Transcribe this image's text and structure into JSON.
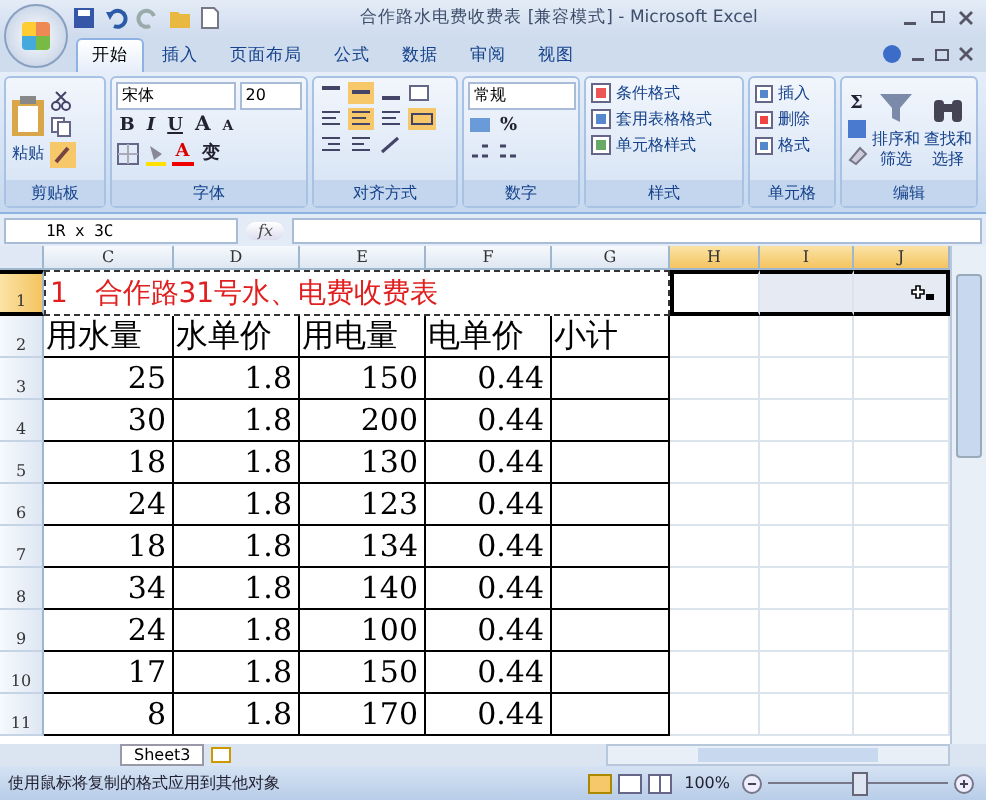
{
  "window": {
    "title": "合作路水电费收费表 [兼容模式] - Microsoft Excel"
  },
  "tabs": [
    {
      "label": "开始",
      "selected": true
    },
    {
      "label": "插入",
      "selected": false
    },
    {
      "label": "页面布局",
      "selected": false
    },
    {
      "label": "公式",
      "selected": false
    },
    {
      "label": "数据",
      "selected": false
    },
    {
      "label": "审阅",
      "selected": false
    },
    {
      "label": "视图",
      "selected": false
    }
  ],
  "ribbon": {
    "clipboard": {
      "label": "剪贴板",
      "paste": "粘贴"
    },
    "font": {
      "label": "字体",
      "family": "宋体",
      "size": "20",
      "buttons": [
        "B",
        "I",
        "U"
      ],
      "grow": "A",
      "shrink": "A",
      "font_color_button": "A",
      "phonetic": "变"
    },
    "alignment": {
      "label": "对齐方式"
    },
    "number": {
      "label": "数字",
      "format": "常规",
      "percent": "%"
    },
    "styles": {
      "label": "样式",
      "items": [
        "条件格式",
        "套用表格格式",
        "单元格样式"
      ]
    },
    "cells": {
      "label": "单元格",
      "items": [
        "插入",
        "删除",
        "格式"
      ]
    },
    "editing": {
      "label": "编辑",
      "sigma": "Σ",
      "sort": [
        "排序和",
        "筛选"
      ],
      "find": [
        "查找和",
        "选择"
      ]
    }
  },
  "formula_bar": {
    "name_box": "1R x 3C",
    "fx": "fx"
  },
  "sheet": {
    "columns": [
      {
        "label": "C",
        "selected": false
      },
      {
        "label": "D",
        "selected": false
      },
      {
        "label": "E",
        "selected": false
      },
      {
        "label": "F",
        "selected": false
      },
      {
        "label": "G",
        "selected": false
      },
      {
        "label": "H",
        "selected": true
      },
      {
        "label": "I",
        "selected": true
      },
      {
        "label": "J",
        "selected": true
      }
    ],
    "title_row": {
      "number": "1",
      "selected": true,
      "text": "1   合作路31号水、电费收费表"
    },
    "header_row": {
      "number": "2",
      "selected": false,
      "cells": [
        "用水量",
        "水单价",
        "用电量",
        "电单价",
        "小计"
      ]
    },
    "rows": [
      {
        "number": "3",
        "selected": false,
        "cells": [
          "25",
          "1.8",
          "150",
          "0.44"
        ]
      },
      {
        "number": "4",
        "selected": false,
        "cells": [
          "30",
          "1.8",
          "200",
          "0.44"
        ]
      },
      {
        "number": "5",
        "selected": false,
        "cells": [
          "18",
          "1.8",
          "130",
          "0.44"
        ]
      },
      {
        "number": "6",
        "selected": false,
        "cells": [
          "24",
          "1.8",
          "123",
          "0.44"
        ]
      },
      {
        "number": "7",
        "selected": false,
        "cells": [
          "18",
          "1.8",
          "134",
          "0.44"
        ]
      },
      {
        "number": "8",
        "selected": false,
        "cells": [
          "34",
          "1.8",
          "140",
          "0.44"
        ]
      },
      {
        "number": "9",
        "selected": false,
        "cells": [
          "24",
          "1.8",
          "100",
          "0.44"
        ]
      },
      {
        "number": "10",
        "selected": false,
        "cells": [
          "17",
          "1.8",
          "150",
          "0.44"
        ]
      },
      {
        "number": "11",
        "selected": false,
        "cells": [
          "8",
          "1.8",
          "170",
          "0.44"
        ]
      }
    ]
  },
  "sheet_tabs": [
    {
      "label": "Sheet3",
      "selected": false
    }
  ],
  "status_bar": {
    "message": "使用鼠标将复制的格式应用到其他对象",
    "zoom": "100%",
    "zoom_slider": {
      "level": 0.5
    }
  }
}
